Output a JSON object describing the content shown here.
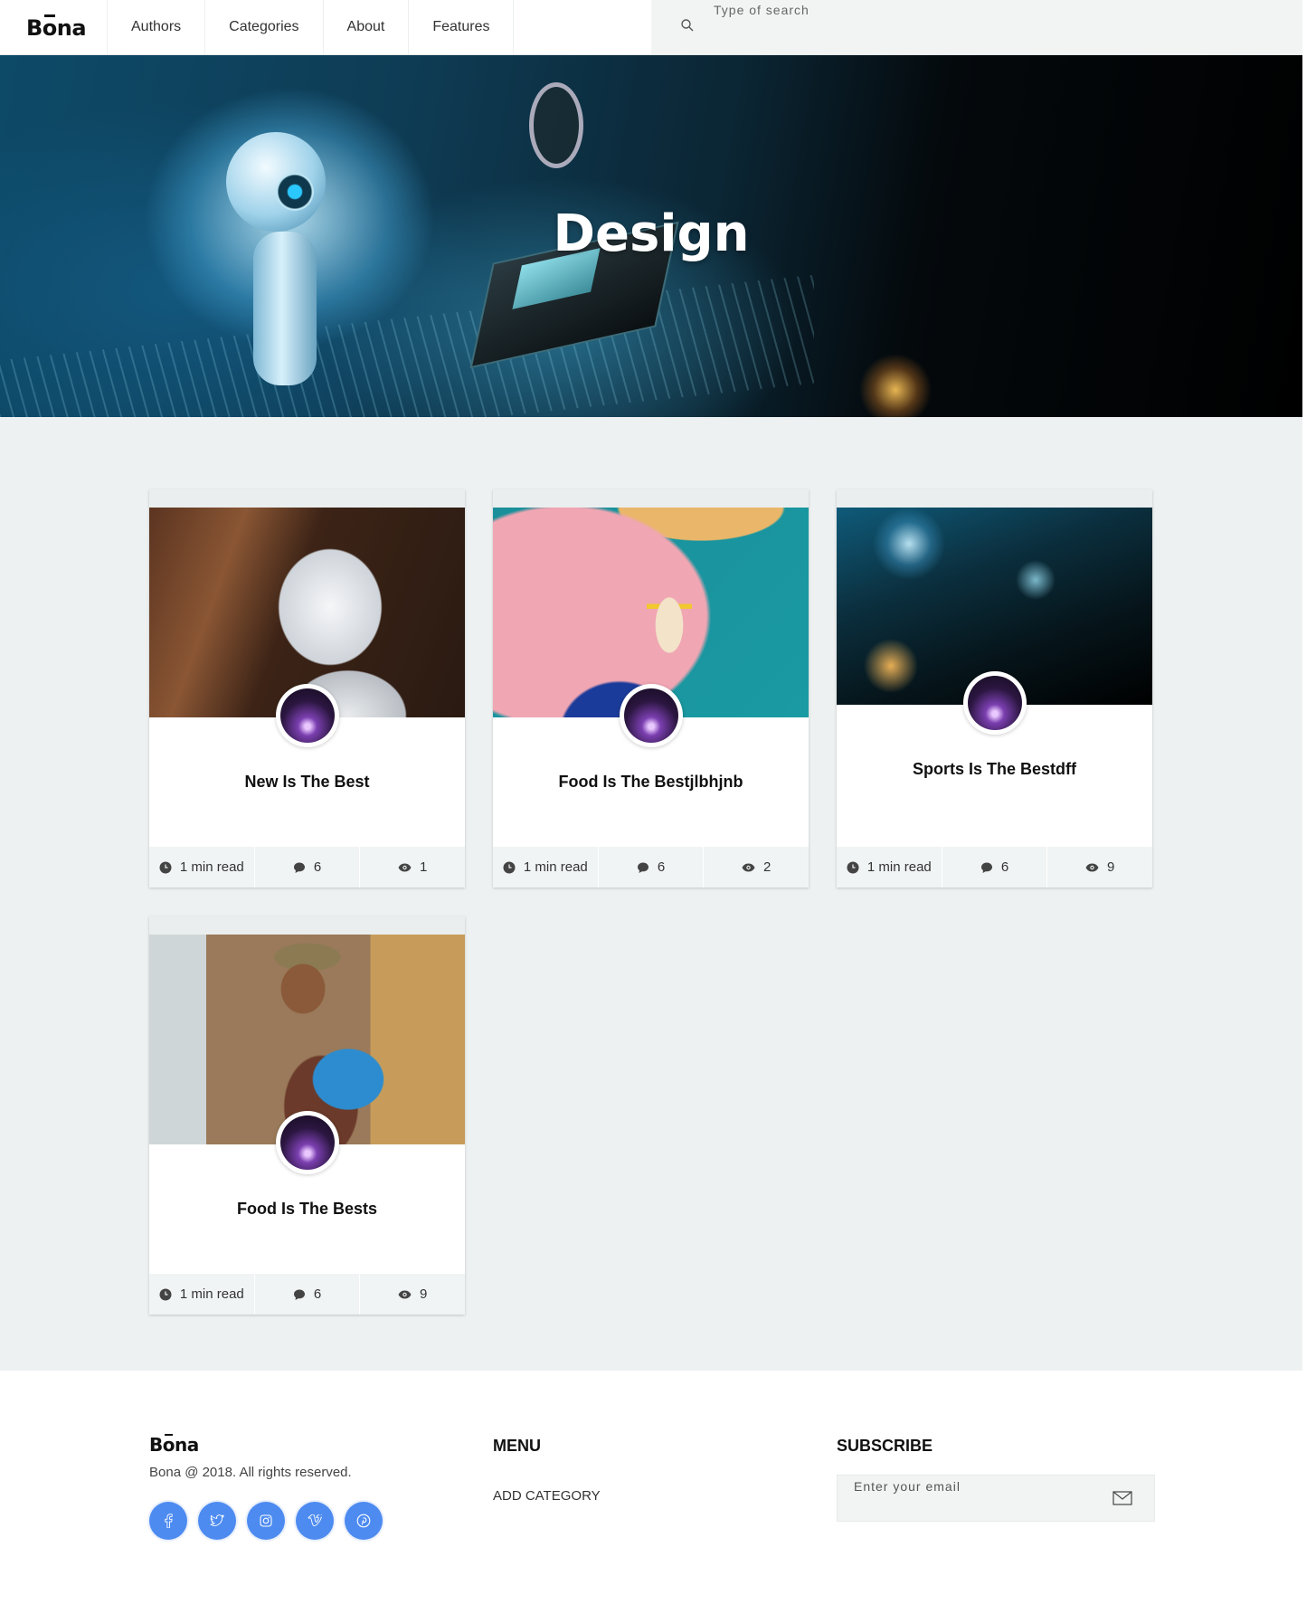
{
  "header": {
    "logo": "Bona",
    "nav": [
      "Authors",
      "Categories",
      "About",
      "Features"
    ],
    "search_placeholder": "Type of search"
  },
  "hero": {
    "title": "Design"
  },
  "posts": [
    {
      "title": "New Is The Best",
      "read_time": "1 min read",
      "comments": "6",
      "views": "1"
    },
    {
      "title": "Food Is The Bestjlbhjnb",
      "read_time": "1 min read",
      "comments": "6",
      "views": "2"
    },
    {
      "title": "Sports Is The Bestdff",
      "read_time": "1 min read",
      "comments": "6",
      "views": "9"
    },
    {
      "title": "Food Is The Bests",
      "read_time": "1 min read",
      "comments": "6",
      "views": "9"
    }
  ],
  "footer": {
    "logo": "Bona",
    "copyright": "Bona @ 2018. All rights reserved.",
    "socials": [
      "facebook-icon",
      "twitter-icon",
      "instagram-icon",
      "vimeo-icon",
      "pinterest-icon"
    ],
    "menu_heading": "MENU",
    "menu_items": [
      "ADD CATEGORY"
    ],
    "subscribe_heading": "SUBSCRIBE",
    "subscribe_placeholder": "Enter your email"
  },
  "colors": {
    "accent": "#4d8bf0",
    "page_bg": "#edf1f1",
    "card_footer_bg": "#f1f4f4"
  }
}
